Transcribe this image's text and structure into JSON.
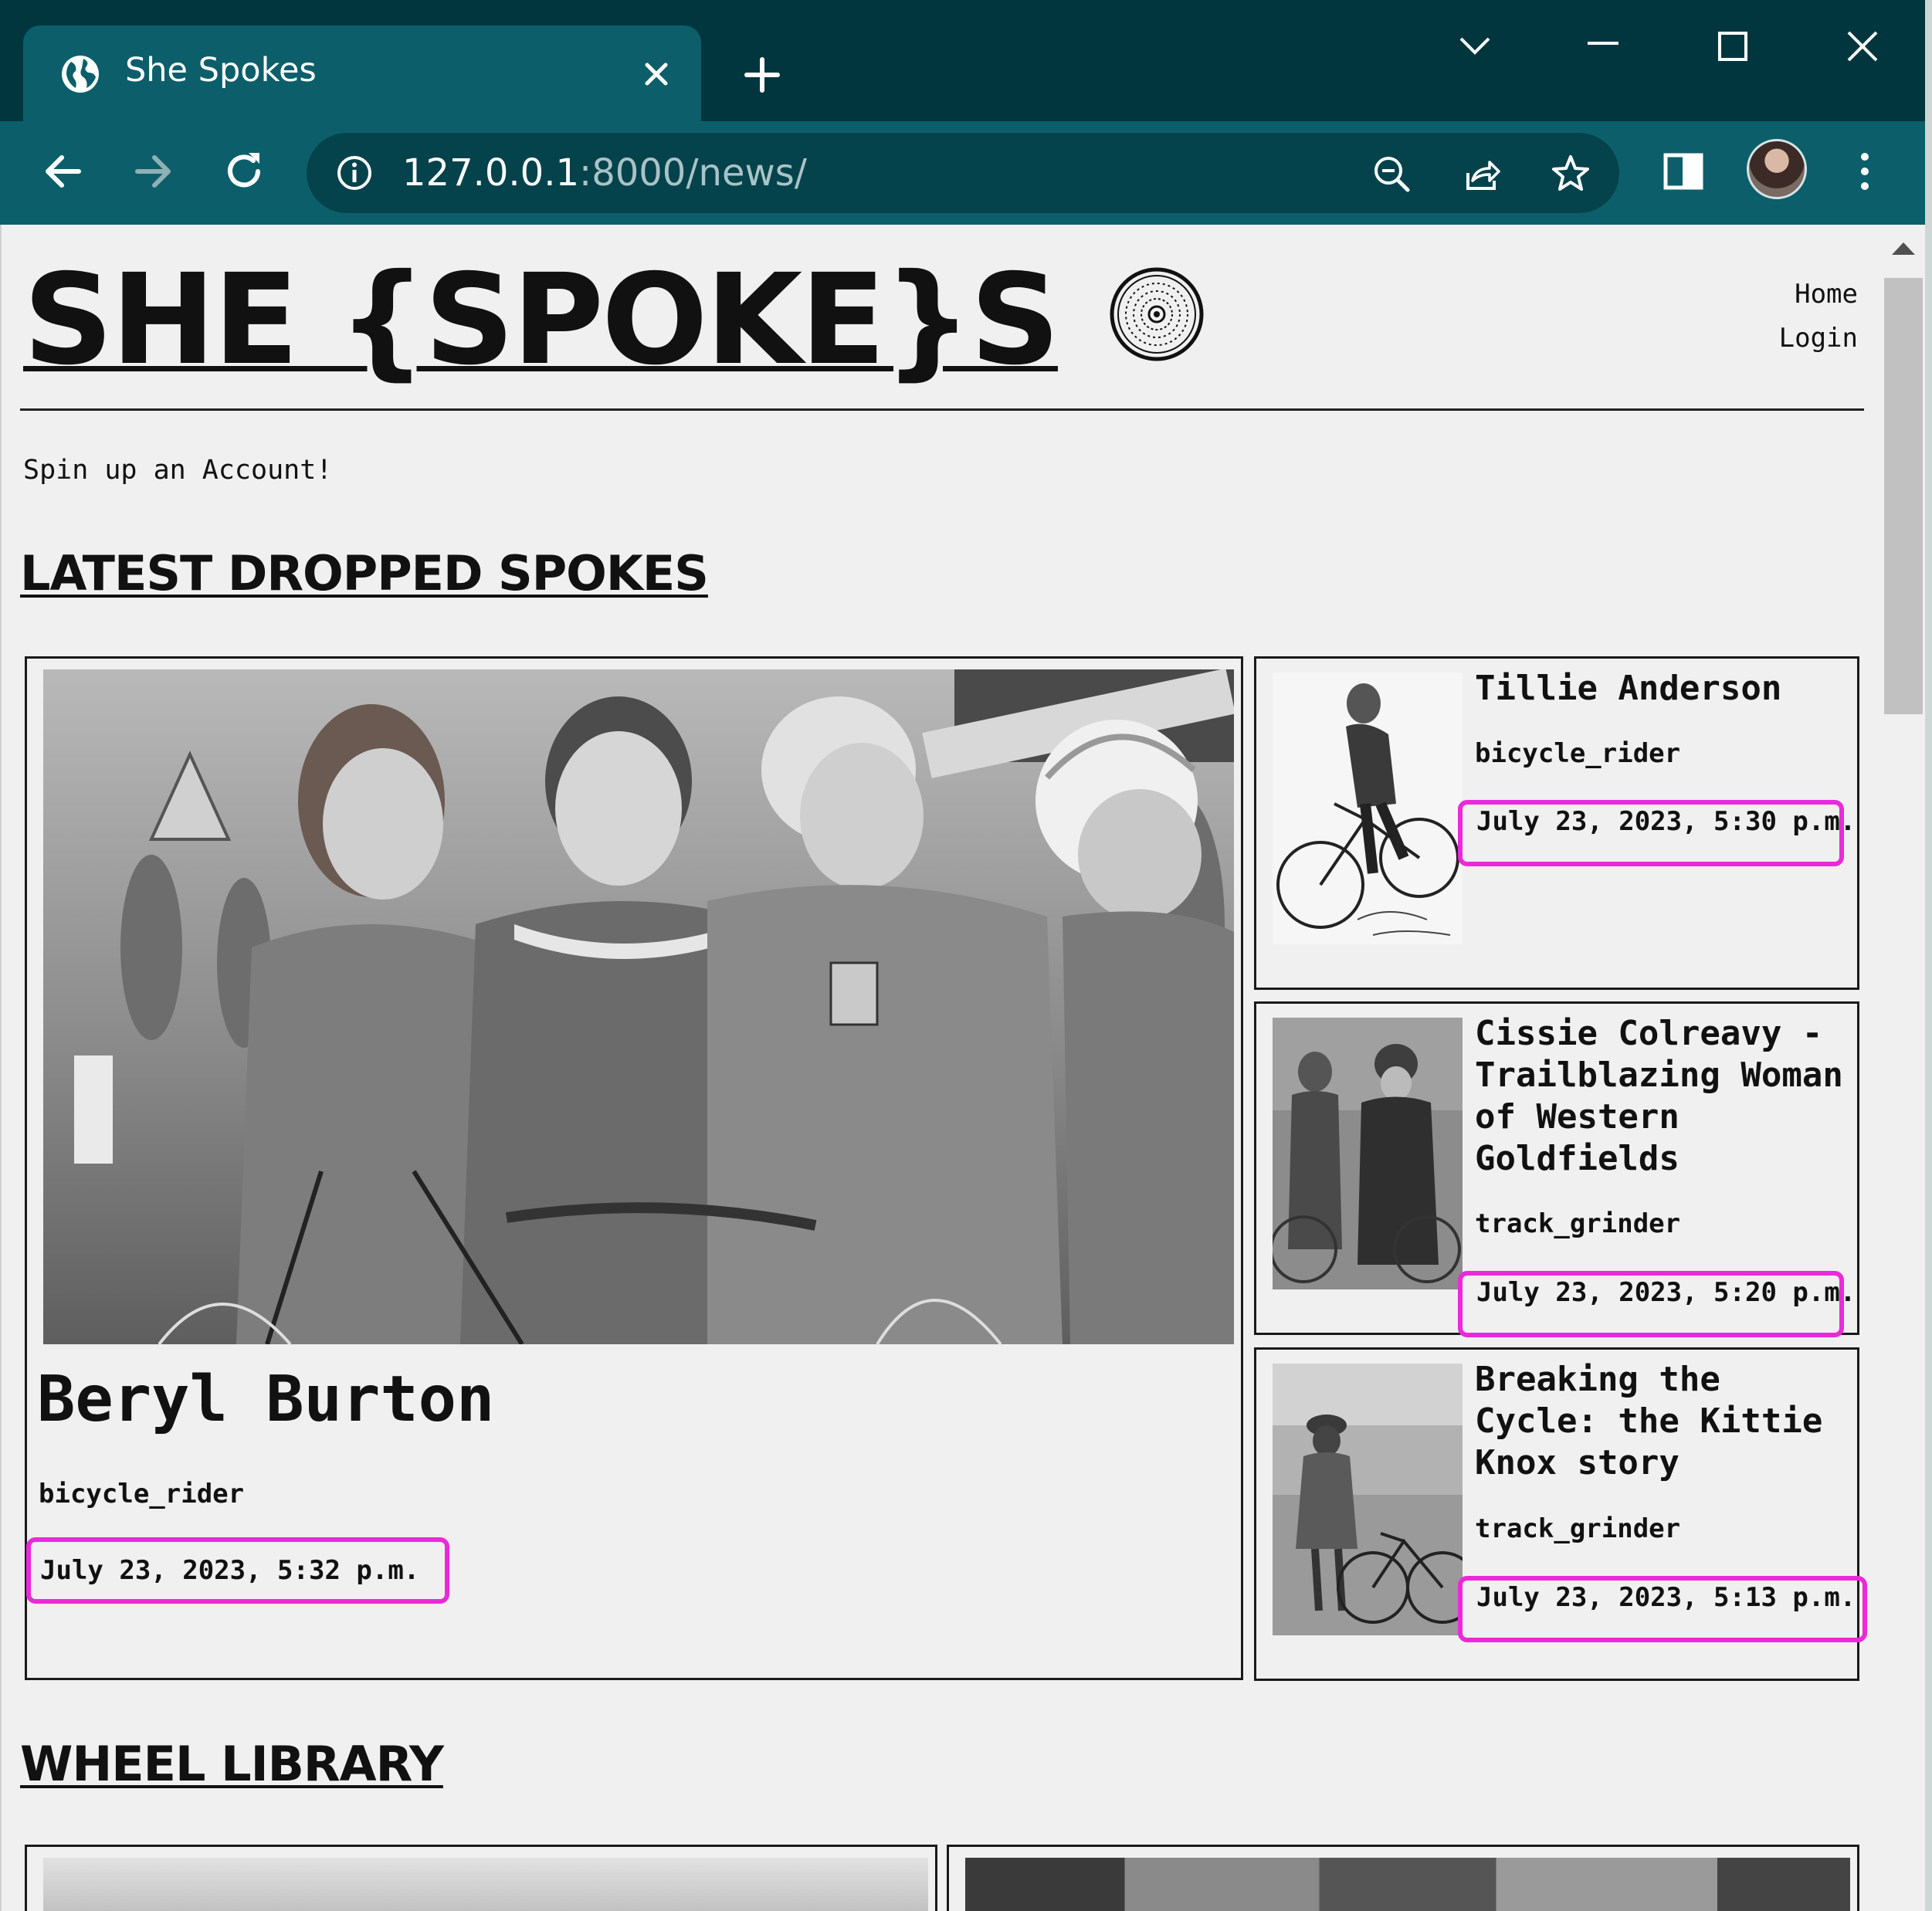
{
  "browser": {
    "tab_title": "She Spokes",
    "url_host": "127.0.0.1",
    "url_path": ":8000/news/"
  },
  "site": {
    "logo": "SHE {SPOKE}S",
    "nav": [
      "Home",
      "Login"
    ],
    "signup_text": "Spin up an Account!"
  },
  "sections": {
    "latest": "LATEST DROPPED SPOKES",
    "library": "WHEEL LIBRARY"
  },
  "featured": {
    "title": "Beryl Burton",
    "author": "bicycle_rider",
    "date": "July 23, 2023, 5:32 p.m."
  },
  "side_posts": [
    {
      "title": "Tillie Anderson",
      "author": "bicycle_rider",
      "date": "July 23, 2023, 5:30 p.m."
    },
    {
      "title": "Cissie Colreavy - Trailblazing Woman of Western Goldfields",
      "author": "track_grinder",
      "date": "July 23, 2023, 5:20 p.m."
    },
    {
      "title": "Breaking the Cycle: the Kittie Knox story",
      "author": "track_grinder",
      "date": "July 23, 2023, 5:13 p.m."
    }
  ],
  "colors": {
    "chrome_dark": "#01363e",
    "chrome_teal": "#0c5f6a",
    "highlight": "#ea2ad8",
    "page_bg": "#f0f0f0"
  },
  "icons": {
    "tab": "globe-icon",
    "close": "close-icon",
    "new_tab": "plus-icon",
    "back": "arrow-left-icon",
    "forward": "arrow-right-icon",
    "reload": "reload-icon",
    "info": "info-icon",
    "zoom": "zoom-out-icon",
    "share": "share-icon",
    "bookmark": "star-icon",
    "side_panel": "side-panel-icon",
    "menu": "kebab-menu-icon",
    "logo_mark": "bicycle-wheel-icon"
  }
}
